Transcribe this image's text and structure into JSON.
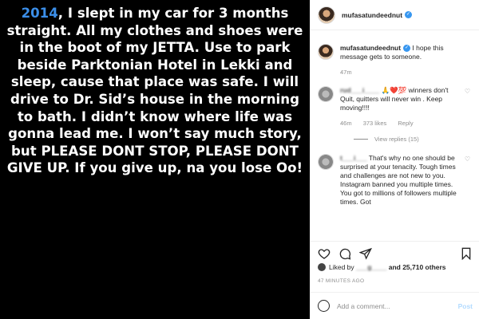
{
  "story": {
    "year": "2014",
    "text_after_year": ", I slept in my car for 3 months straight. All my clothes and shoes were in the boot of my JETTA. Use to park beside Parktonian Hotel in Lekki and sleep, cause that place was safe. I will drive to Dr. Sid’s house in the morning to bath. I didn’t know where life was gonna lead me. I won’t say much story, but PLEASE DONT STOP, PLEASE DONT GIVE UP. If you give up, na you lose Oo!"
  },
  "header": {
    "username": "mufasatundeednut",
    "verified_icon": "✓",
    "more_icon": "•••"
  },
  "caption": {
    "username": "mufasatundeednut",
    "text": " I hope this message gets to someone.",
    "time": "47m"
  },
  "comments": [
    {
      "username": "rud___i____",
      "text": "🙏❤️💯 winners don't Quit, quitters will never win . Keep moving!!!!",
      "time": "46m",
      "likes": "373 likes",
      "reply": "Reply",
      "view_replies": "View replies (15)"
    },
    {
      "username": "t___i___",
      "text": " That's why no one should be surprised at your tenacity. Tough times and challenges are not new to you. Instagram banned you multiple times. You got to millions of followers multiple times. Got"
    }
  ],
  "likes": {
    "prefix": "Liked by",
    "user": "___g____",
    "suffix": "and 25,710 others"
  },
  "timestamp": "47 MINUTES AGO",
  "add_comment": {
    "placeholder": "Add a comment...",
    "post_label": "Post"
  },
  "colors": {
    "year": "#3b8ee8",
    "verified": "#3897f0",
    "post_button": "#b3dbff"
  }
}
